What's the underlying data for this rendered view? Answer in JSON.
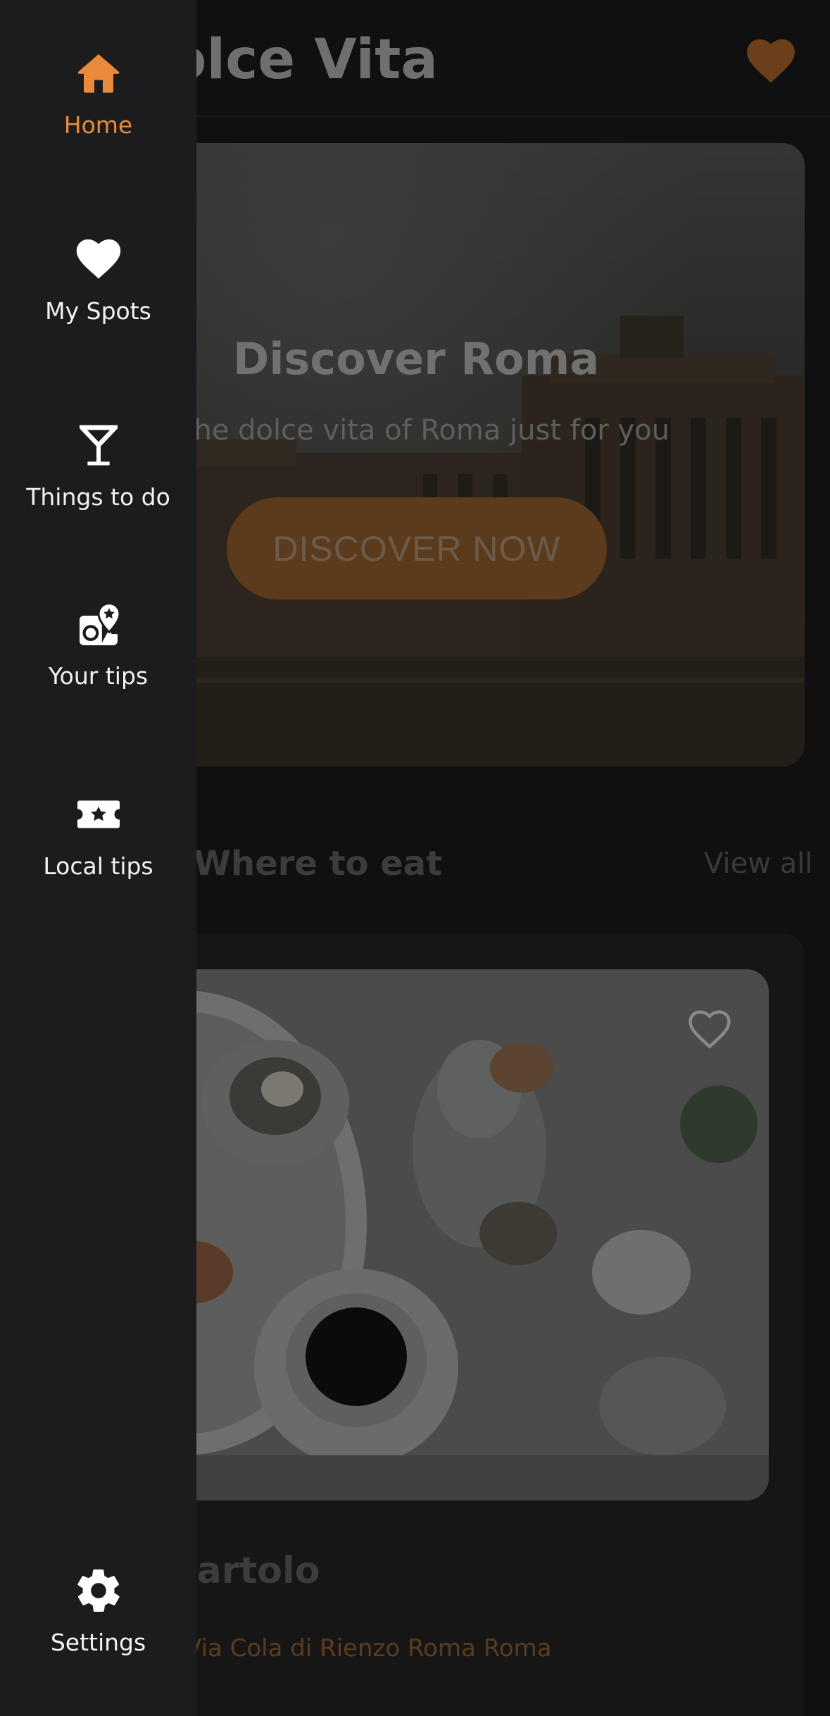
{
  "header": {
    "title": "Dolce Vita",
    "favorites_icon": "heart-icon"
  },
  "hero": {
    "title": "Discover Roma",
    "subtitle": "The dolce vita of Roma just for you",
    "button_label": "DISCOVER NOW"
  },
  "section": {
    "title": "Where to eat",
    "view_all_label": "View all"
  },
  "card": {
    "name": "Bartolo",
    "address": "Via Cola di Rienzo Roma Roma",
    "favorite_icon": "heart-outline-icon"
  },
  "drawer": {
    "items": [
      {
        "label": "Home",
        "icon": "home-icon",
        "active": true
      },
      {
        "label": "My Spots",
        "icon": "heart-icon",
        "active": false
      },
      {
        "label": "Things to do",
        "icon": "cocktail-glass-icon",
        "active": false
      },
      {
        "label": "Your tips",
        "icon": "map-pin-star-icon",
        "active": false
      },
      {
        "label": "Local tips",
        "icon": "ticket-star-icon",
        "active": false
      }
    ],
    "settings": {
      "label": "Settings",
      "icon": "gear-icon"
    }
  },
  "colors": {
    "accent": "#E8893C",
    "drawer_background": "#1C1C1E",
    "page_background": "#101010"
  }
}
